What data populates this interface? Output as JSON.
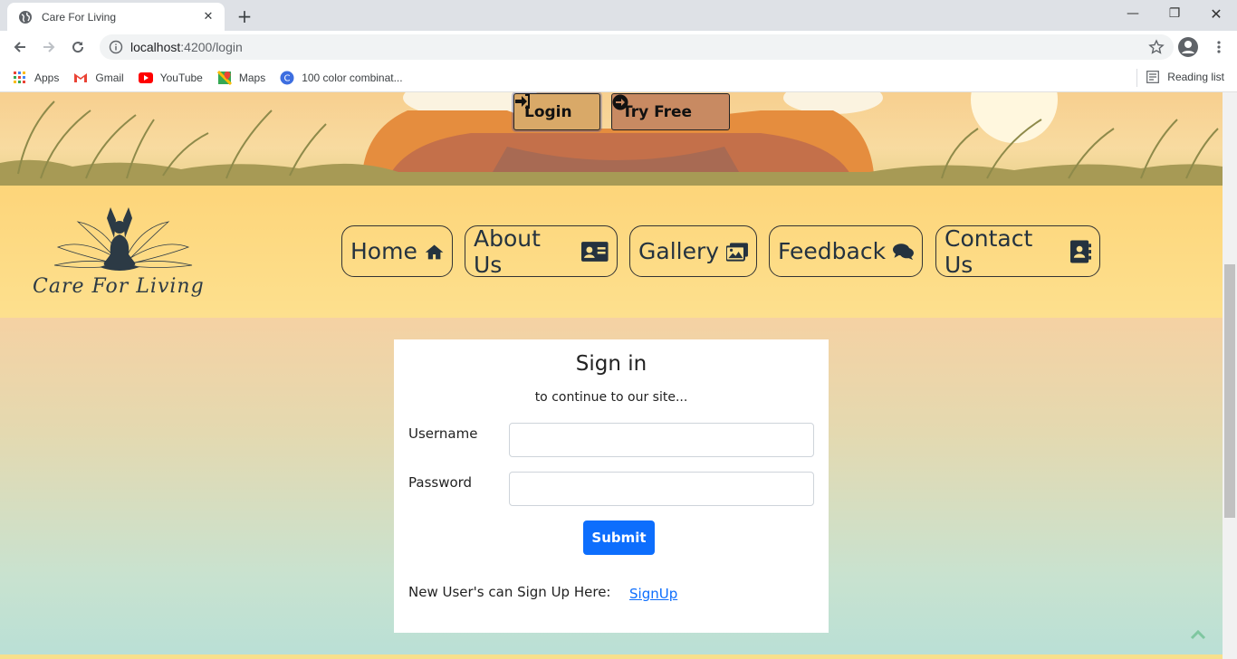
{
  "browser": {
    "tab_title": "Care For Living",
    "url_host": "localhost",
    "url_path": ":4200/login",
    "bookmarks": [
      {
        "label": "Apps",
        "icon": "apps-grid-icon"
      },
      {
        "label": "Gmail",
        "icon": "gmail-icon"
      },
      {
        "label": "YouTube",
        "icon": "youtube-icon"
      },
      {
        "label": "Maps",
        "icon": "maps-icon"
      },
      {
        "label": "100 color combinat...",
        "icon": "canva-icon"
      }
    ],
    "reading_list": "Reading list"
  },
  "hero": {
    "login_label": "Login",
    "try_label": "Try Free"
  },
  "header": {
    "logo_text": "Care For Living",
    "nav": [
      {
        "label": "Home",
        "icon": "home-icon"
      },
      {
        "label": "About Us",
        "icon": "id-card-icon"
      },
      {
        "label": "Gallery",
        "icon": "images-icon"
      },
      {
        "label": "Feedback",
        "icon": "comments-icon"
      },
      {
        "label": "Contact Us",
        "icon": "address-book-icon"
      }
    ]
  },
  "signin": {
    "title": "Sign in",
    "subtitle": "to continue to our site...",
    "username_label": "Username",
    "username_value": "",
    "password_label": "Password",
    "password_value": "",
    "submit_label": "Submit",
    "signup_text": "New User's can Sign Up Here:",
    "signup_link": "SignUp"
  },
  "colors": {
    "accent": "#0d6efd",
    "header_bg": "#fdd57a",
    "text": "#24323f"
  }
}
